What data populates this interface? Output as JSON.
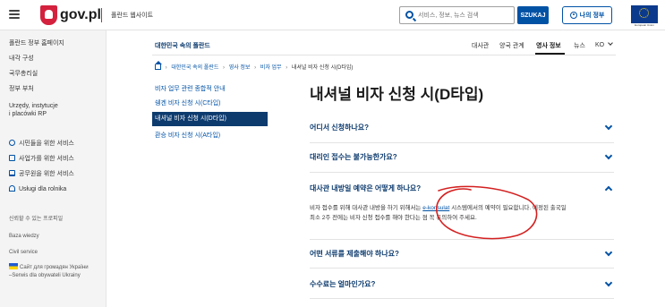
{
  "header": {
    "logo_text": "gov.pl",
    "site_name": "폴란드 웹사이트",
    "search_placeholder": "서비스, 정보, 뉴스 검색",
    "search_button": "SZUKAJ",
    "account_button": "나의 정부",
    "eu_label": "European Union",
    "icons": [
      "menu-icon",
      "emblem-icon",
      "search-icon",
      "account-icon",
      "eu-flag-icon"
    ]
  },
  "sidebar": {
    "links": [
      "폴란드 정부 홈페이지",
      "내각 구성",
      "국무총리실",
      "정부 부처",
      "Urzędy, instytucje",
      "i placówki RP"
    ],
    "services": [
      {
        "icon": "person-icon",
        "label": "시민들을 위한 서비스"
      },
      {
        "icon": "briefcase-icon",
        "label": "사업가를 위한 서비스"
      },
      {
        "icon": "government-icon",
        "label": "공무원을 위한 서비스"
      },
      {
        "icon": "agriculture-icon",
        "label": "Usługi dla rolnika"
      }
    ],
    "section_label": "신뢰할 수 있는 프로피일",
    "extra_links": [
      "Baza wiedzy",
      "Civil service"
    ],
    "ukraine_line1": "Сайт для громадян України",
    "ukraine_line2": "–Serwis dla obywateli Ukrainy"
  },
  "main": {
    "embassy_link": "대한민국 속의 폴란드",
    "topnav": [
      "대사관",
      "양국 관계",
      "영사 정보",
      "뉴스"
    ],
    "topnav_active": "영사 정보",
    "language": "KO",
    "breadcrumb": [
      "대한민국 속의 폴란드",
      "영사 정보",
      "비자 업무",
      "내셔널 비자 신청 시(D타입)"
    ],
    "subnav": [
      "비자 업무 관련 종합적 안내",
      "쉥겐 비자 신청 시(C타입)",
      "내셔널 비자 신청 시(D타입)",
      "환승 비자 신청 시(A타입)"
    ],
    "subnav_active_index": 2,
    "title": "내셔널 비자 신청 시(D타입)",
    "accordion": [
      {
        "question": "어디서 신청하나요?",
        "expanded": false
      },
      {
        "question": "대리인 접수는 불가능한가요?",
        "expanded": false
      },
      {
        "question": "대사관 내방일 예약은 어떻게 하나요?",
        "expanded": true
      },
      {
        "question": "어떤 서류를 제출해야 하나요?",
        "expanded": false
      },
      {
        "question": "수수료는 얼마인가요?",
        "expanded": false
      }
    ],
    "answer_before": "비자 접수를 위해 대사관 내방을 하기 위해서는 ",
    "answer_link": "e-konsulat",
    "answer_after": " 시스템에서의 예약이 필요합니다. 예정된 출국일",
    "answer_line2": "최소 2주 전에는 비자 신청 접수를 해야 한다는 점 꼭 유의하여 주세요."
  },
  "colors": {
    "brand_red": "#d4213d",
    "primary_blue": "#0052a5",
    "navy": "#0d3b6e",
    "annotation_red": "#d42020"
  }
}
